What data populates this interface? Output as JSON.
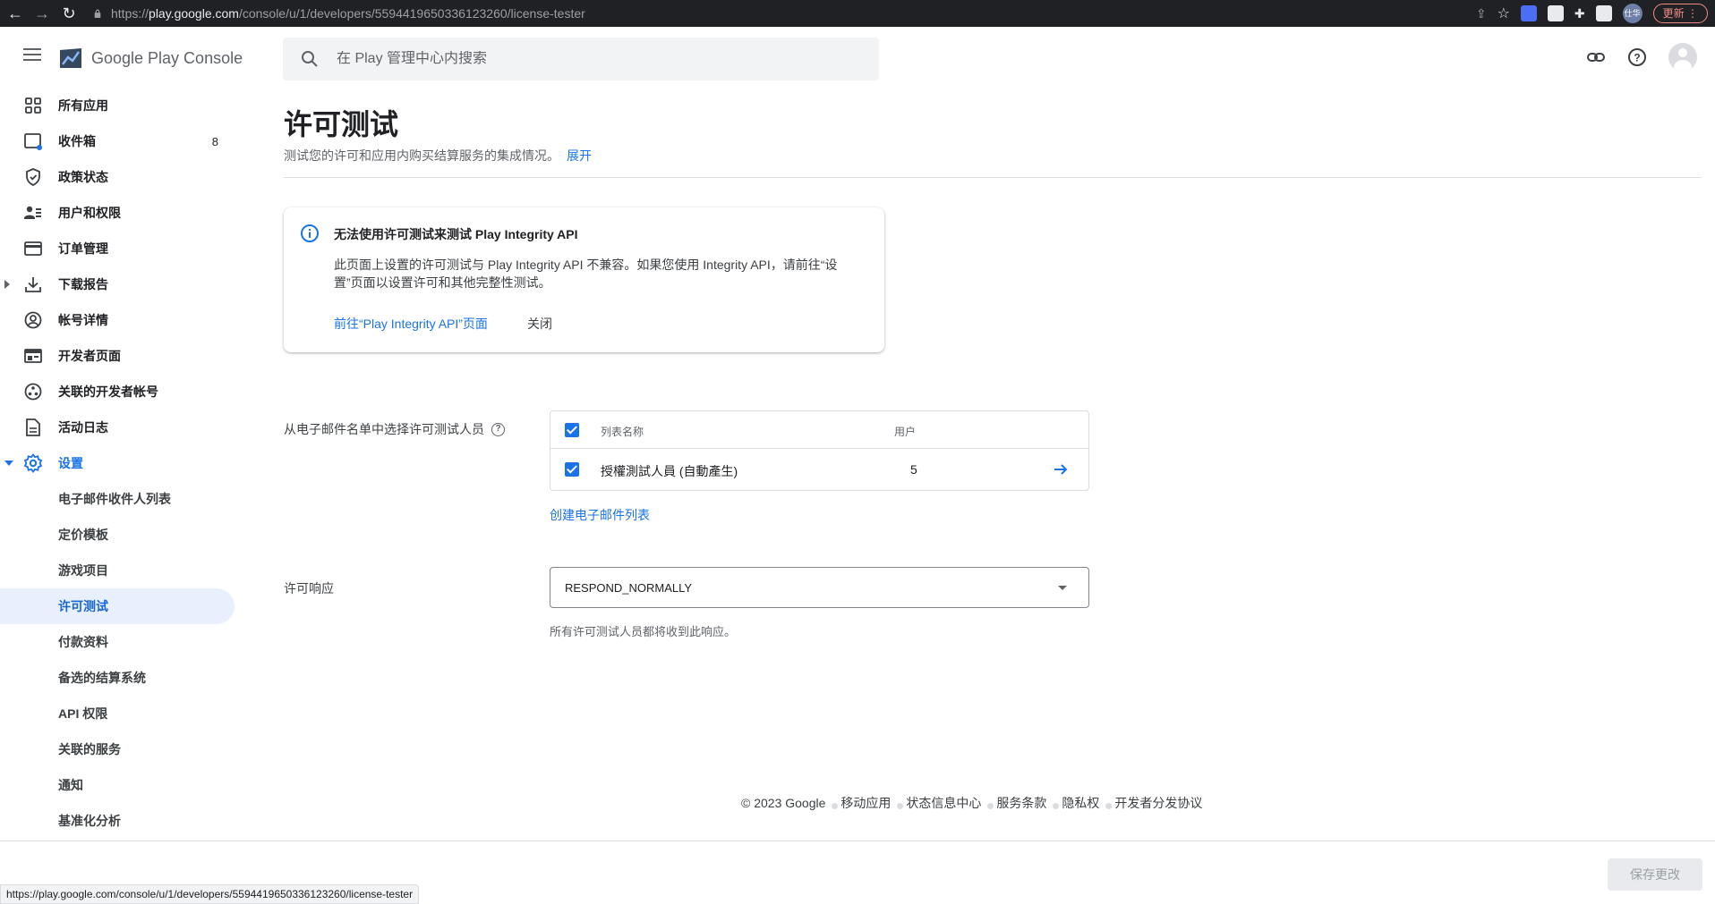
{
  "browser": {
    "url_prefix": "https://",
    "url_host": "play.google.com",
    "url_path": "/console/u/1/developers/5594419650336123260/license-tester",
    "profile_label": "仕华",
    "update_label": "更新"
  },
  "header": {
    "logo_text": "Google Play Console",
    "search_placeholder": "在 Play 管理中心内搜索"
  },
  "sidebar": {
    "items": [
      {
        "label": "所有应用",
        "icon": "apps-grid-icon"
      },
      {
        "label": "收件箱",
        "icon": "inbox-icon",
        "count": "8"
      },
      {
        "label": "政策状态",
        "icon": "shield-icon"
      },
      {
        "label": "用户和权限",
        "icon": "users-icon"
      },
      {
        "label": "订单管理",
        "icon": "credit-card-icon"
      },
      {
        "label": "下载报告",
        "icon": "download-icon"
      },
      {
        "label": "帐号详情",
        "icon": "account-circle-icon"
      },
      {
        "label": "开发者页面",
        "icon": "web-page-icon"
      },
      {
        "label": "关联的开发者帐号",
        "icon": "linked-accounts-icon"
      },
      {
        "label": "活动日志",
        "icon": "document-icon"
      },
      {
        "label": "设置",
        "icon": "gear-icon"
      }
    ],
    "settings_subitems": [
      "电子邮件收件人列表",
      "定价模板",
      "游戏项目",
      "许可测试",
      "付款资料",
      "备选的结算系统",
      "API 权限",
      "关联的服务",
      "通知",
      "基准化分析"
    ]
  },
  "main": {
    "title": "许可测试",
    "description": "测试您的许可和应用内购买结算服务的集成情况。",
    "expand_label": "展开",
    "notice": {
      "title": "无法使用许可测试来测试 Play Integrity API",
      "body": "此页面上设置的许可测试与 Play Integrity API 不兼容。如果您使用 Integrity API，请前往“设置”页面以设置许可和其他完整性测试。",
      "link_label": "前往“Play Integrity API”页面",
      "close_label": "关闭"
    },
    "testers": {
      "label": "从电子邮件名单中选择许可测试人员",
      "help_icon": "?",
      "columns": {
        "name": "列表名称",
        "users": "用户"
      },
      "rows": [
        {
          "name": "授權測試人員 (自動產生)",
          "users": "5"
        }
      ],
      "create_link": "创建电子邮件列表"
    },
    "license_response": {
      "label": "许可响应",
      "value": "RESPOND_NORMALLY",
      "help": "所有许可测试人员都将收到此响应。"
    }
  },
  "footer": {
    "copyright": "© 2023 Google",
    "links": [
      "移动应用",
      "状态信息中心",
      "服务条款",
      "隐私权",
      "开发者分发协议"
    ]
  },
  "actions": {
    "save_label": "保存更改"
  },
  "status_url": "https://play.google.com/console/u/1/developers/5594419650336123260/license-tester"
}
